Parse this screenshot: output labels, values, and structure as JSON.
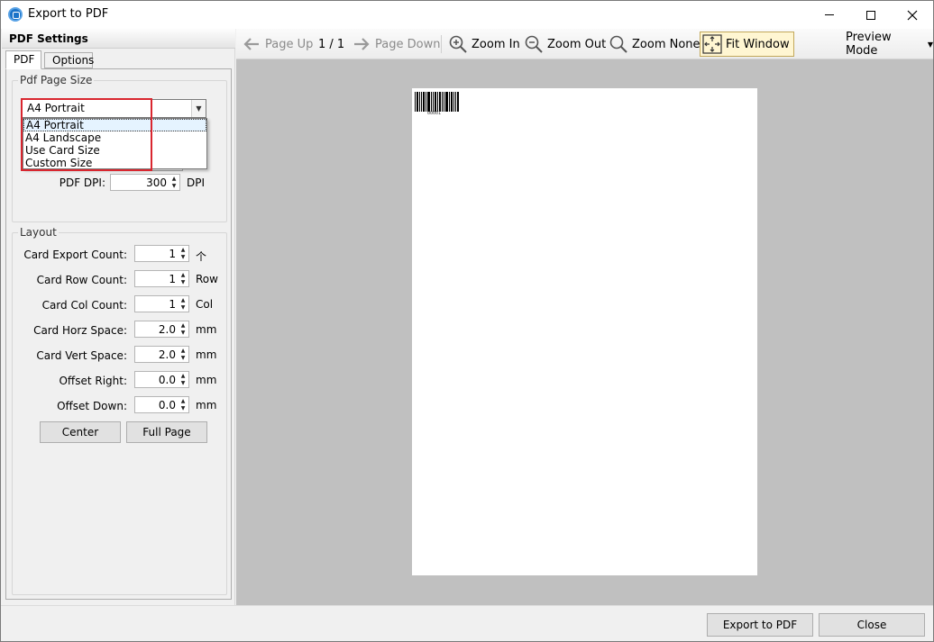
{
  "window": {
    "title": "Export to PDF"
  },
  "left_panel": {
    "header": "PDF Settings",
    "tabs": [
      {
        "label": "PDF",
        "active": true
      },
      {
        "label": "Options",
        "active": false
      }
    ],
    "page_size_group": {
      "title": "Pdf Page Size",
      "combo_value": "A4 Portrait",
      "options": [
        "A4 Portrait",
        "A4 Landscape",
        "Use Card Size",
        "Custom Size"
      ],
      "dpi_label": "PDF DPI:",
      "dpi_value": "300",
      "dpi_unit": "DPI"
    },
    "layout_group": {
      "title": "Layout",
      "fields": [
        {
          "label": "Card Export Count:",
          "value": "1",
          "unit": "个"
        },
        {
          "label": "Card Row Count:",
          "value": "1",
          "unit": "Row"
        },
        {
          "label": "Card Col Count:",
          "value": "1",
          "unit": "Col"
        },
        {
          "label": "Card Horz Space:",
          "value": "2.0",
          "unit": "mm"
        },
        {
          "label": "Card Vert Space:",
          "value": "2.0",
          "unit": "mm"
        },
        {
          "label": "Offset Right:",
          "value": "0.0",
          "unit": "mm"
        },
        {
          "label": "Offset Down:",
          "value": "0.0",
          "unit": "mm"
        }
      ],
      "center_label": "Center",
      "full_page_label": "Full Page"
    }
  },
  "toolbar": {
    "page_up": "Page Up",
    "page_indicator": "1 / 1",
    "page_down": "Page Down",
    "zoom_in": "Zoom In",
    "zoom_out": "Zoom Out",
    "zoom_none": "Zoom None",
    "fit_window": "Fit Window",
    "preview_mode": "Preview Mode"
  },
  "preview": {
    "barcode_text": "00001"
  },
  "bottom": {
    "export_label": "Export to PDF",
    "close_label": "Close"
  },
  "colors": {
    "highlight": "#d9262f",
    "preview_bg": "#c0c0c0",
    "fit_window_bg": "#fff6d2"
  }
}
